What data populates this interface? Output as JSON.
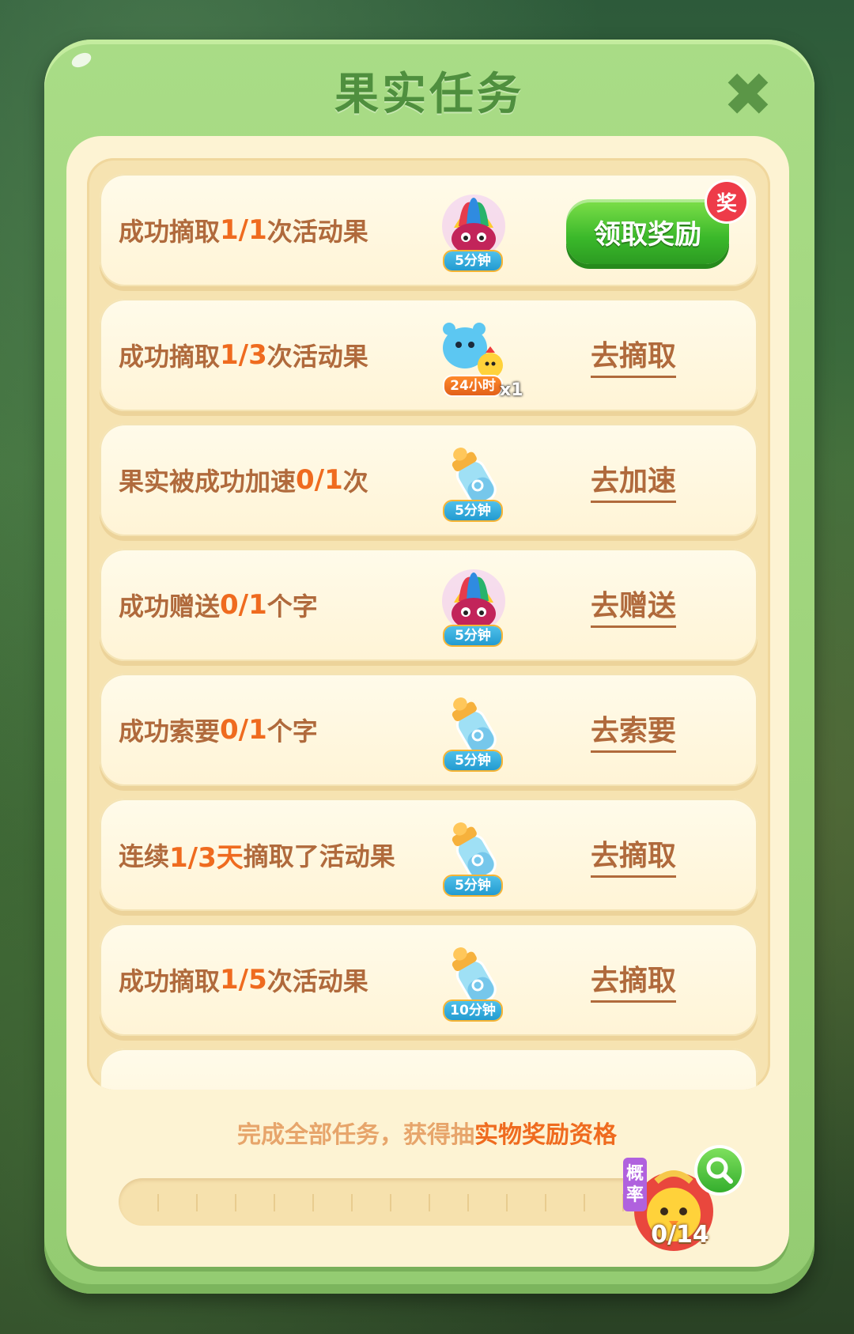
{
  "dialog": {
    "title": "果实任务",
    "close_icon": "close-icon"
  },
  "tasks": [
    {
      "prefix": "成功摘取",
      "progress": "1/1",
      "suffix": "次活动果",
      "reward_icon": "feather-bird-icon",
      "reward_badge": "5分钟",
      "action": "领取奖励",
      "action_type": "claim",
      "tag": "奖"
    },
    {
      "prefix": "成功摘取",
      "progress": "1/3",
      "suffix": "次活动果",
      "reward_icon": "pet-duo-icon",
      "reward_badge": "24小时",
      "reward_qty": "x1",
      "action": "去摘取",
      "action_type": "link"
    },
    {
      "prefix": "果实被成功加速",
      "progress": "0/1",
      "suffix": "次",
      "reward_icon": "bottle-icon",
      "reward_badge": "5分钟",
      "action": "去加速",
      "action_type": "link"
    },
    {
      "prefix": "成功赠送",
      "progress": "0/1",
      "suffix": "个字",
      "reward_icon": "feather-bird-icon",
      "reward_badge": "5分钟",
      "action": "去赠送",
      "action_type": "link"
    },
    {
      "prefix": "成功索要",
      "progress": "0/1",
      "suffix": "个字",
      "reward_icon": "bottle-icon",
      "reward_badge": "5分钟",
      "action": "去索要",
      "action_type": "link"
    },
    {
      "prefix": "连续",
      "progress": "1/3天",
      "suffix": "摘取了活动果",
      "reward_icon": "bottle-icon",
      "reward_badge": "5分钟",
      "action": "去摘取",
      "action_type": "link"
    },
    {
      "prefix": "成功摘取",
      "progress": "1/5",
      "suffix": "次活动果",
      "reward_icon": "bottle-icon",
      "reward_badge": "10分钟",
      "action": "去摘取",
      "action_type": "link"
    }
  ],
  "footer": {
    "text_prefix": "完成全部任务，获得抽",
    "text_highlight": "实物奖励资格",
    "probability_tag": [
      "概",
      "率"
    ],
    "progress_count": "0/14",
    "progress_fraction": 0
  },
  "colors": {
    "dialog_green": "#a9dc86",
    "title_green": "#4f8f3e",
    "text_brown": "#b06a3c",
    "progress_orange": "#ef6b1f",
    "claim_green": "#3ab82a",
    "panel_cream": "#fdf3d3"
  }
}
